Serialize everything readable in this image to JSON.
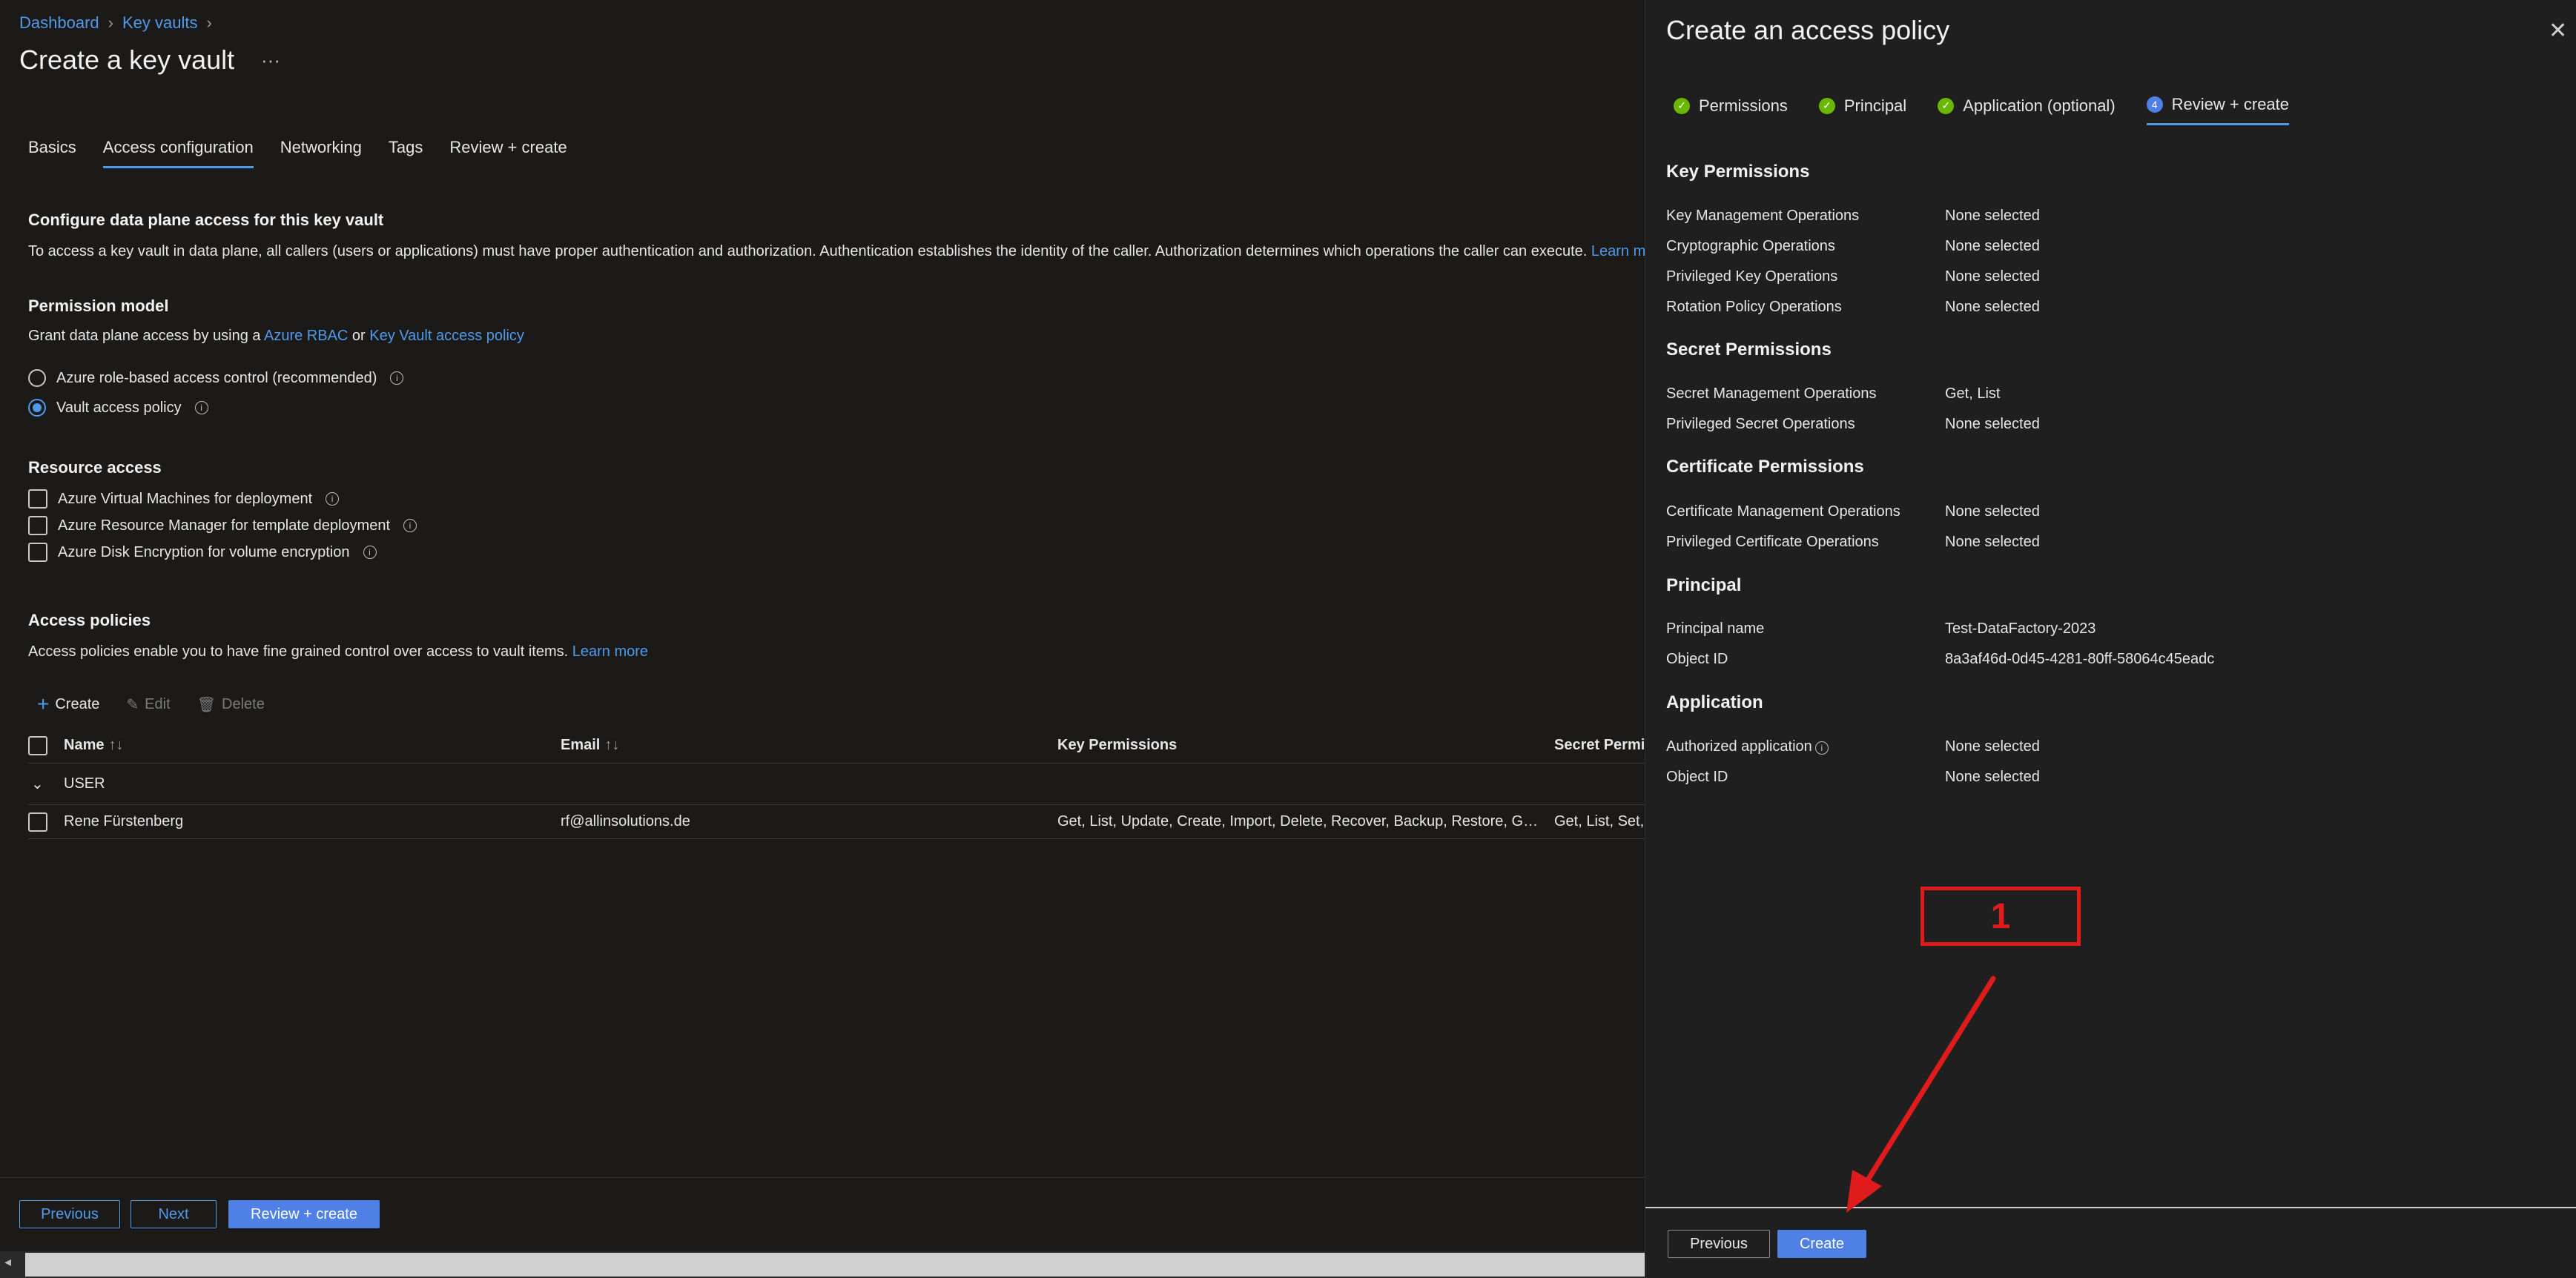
{
  "breadcrumb": {
    "items": [
      "Dashboard",
      "Key vaults"
    ],
    "separator": ">"
  },
  "page": {
    "title": "Create a key vault",
    "more": "···"
  },
  "tabs": [
    "Basics",
    "Access configuration",
    "Networking",
    "Tags",
    "Review + create"
  ],
  "active_tab": "Access configuration",
  "data_plane": {
    "title": "Configure data plane access for this key vault",
    "description": "To access a key vault in data plane, all callers (users or applications) must have proper authentication and authorization. Authentication establishes the identity of the caller. Authorization determines which operations the caller can execute.",
    "learn_more": "Learn more"
  },
  "permission_model": {
    "title": "Permission model",
    "desc_prefix": "Grant data plane access by using a",
    "link1": "Azure RBAC",
    "or": "or",
    "link2": "Key Vault access policy",
    "options": [
      {
        "label": "Azure role-based access control (recommended)",
        "selected": false
      },
      {
        "label": "Vault access policy",
        "selected": true
      }
    ]
  },
  "resource_access": {
    "title": "Resource access",
    "options": [
      "Azure Virtual Machines for deployment",
      "Azure Resource Manager for template deployment",
      "Azure Disk Encryption for volume encryption"
    ]
  },
  "access_policies": {
    "title": "Access policies",
    "description": "Access policies enable you to have fine grained control over access to vault items.",
    "learn_more": "Learn more",
    "toolbar": {
      "create": "Create",
      "edit": "Edit",
      "delete": "Delete"
    },
    "columns": [
      "Name",
      "Email",
      "Key Permissions",
      "Secret Permiss"
    ],
    "group": "USER",
    "rows": [
      {
        "name": "Rene Fürstenberg",
        "email": "rf@allinsolutions.de",
        "key_permissions": "Get, List, Update, Create, Import, Delete, Recover, Backup, Restore, Get Rot...",
        "secret_permissions": "Get, List, Set, D"
      }
    ]
  },
  "footer": {
    "previous": "Previous",
    "next": "Next",
    "review_create": "Review + create"
  },
  "panel": {
    "title": "Create an access policy",
    "close": "✕",
    "steps": [
      {
        "label": "Permissions",
        "state": "done"
      },
      {
        "label": "Principal",
        "state": "done"
      },
      {
        "label": "Application (optional)",
        "state": "done"
      },
      {
        "label": "Review + create",
        "state": "active",
        "number": "4"
      }
    ],
    "key_permissions": {
      "title": "Key Permissions",
      "items": [
        {
          "k": "Key Management Operations",
          "v": "None selected"
        },
        {
          "k": "Cryptographic Operations",
          "v": "None selected"
        },
        {
          "k": "Privileged Key Operations",
          "v": "None selected"
        },
        {
          "k": "Rotation Policy Operations",
          "v": "None selected"
        }
      ]
    },
    "secret_permissions": {
      "title": "Secret Permissions",
      "items": [
        {
          "k": "Secret Management Operations",
          "v": "Get, List"
        },
        {
          "k": "Privileged Secret Operations",
          "v": "None selected"
        }
      ]
    },
    "certificate_permissions": {
      "title": "Certificate Permissions",
      "items": [
        {
          "k": "Certificate Management Operations",
          "v": "None selected"
        },
        {
          "k": "Privileged Certificate Operations",
          "v": "None selected"
        }
      ]
    },
    "principal": {
      "title": "Principal",
      "items": [
        {
          "k": "Principal name",
          "v": "Test-DataFactory-2023"
        },
        {
          "k": "Object ID",
          "v": "8a3af46d-0d45-4281-80ff-58064c45eadc"
        }
      ]
    },
    "application": {
      "title": "Application",
      "items": [
        {
          "k": "Authorized application",
          "v": "None selected"
        },
        {
          "k": "Object ID",
          "v": "None selected"
        }
      ]
    },
    "footer": {
      "previous": "Previous",
      "create": "Create"
    }
  },
  "annotation": {
    "label": "1",
    "color": "#e01b1b"
  },
  "colors": {
    "accent": "#4f9bea",
    "primary_button": "#4f80e6",
    "success": "#6bb700",
    "background": "#1b1a19"
  }
}
